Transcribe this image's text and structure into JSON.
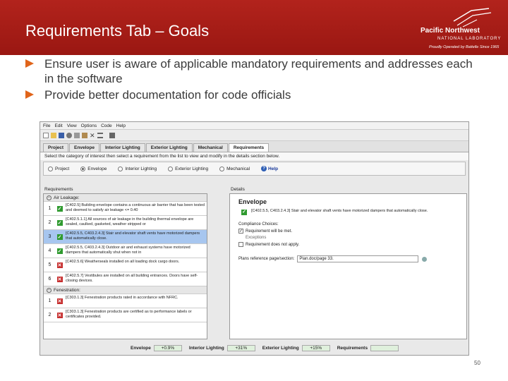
{
  "slide": {
    "title": "Requirements Tab – Goals",
    "bullets": [
      "Ensure user is aware of applicable mandatory requirements and addresses each in the software",
      "Provide better documentation for code officials"
    ],
    "page_number": "50",
    "colors": {
      "header": "#a81c15",
      "bullet": "#e0641a"
    }
  },
  "logo": {
    "name": "Pacific Northwest",
    "subtitle": "NATIONAL LABORATORY",
    "tagline": "Proudly Operated by Battelle Since 1965"
  },
  "app": {
    "menu": [
      "File",
      "Edit",
      "View",
      "Options",
      "Code",
      "Help"
    ],
    "tabs": [
      "Project",
      "Envelope",
      "Interior Lighting",
      "Exterior Lighting",
      "Mechanical",
      "Requirements"
    ],
    "active_tab": "Requirements",
    "instruction": "Select the category of interest then select a requirement from the list to view and modify in the details section below.",
    "categories": [
      "Project",
      "Envelope",
      "Interior Lighting",
      "Exterior Lighting",
      "Mechanical"
    ],
    "selected_category": "Envelope",
    "help_label": "Help",
    "requirements_label": "Requirements",
    "groups": [
      {
        "name": "Air Leakage:",
        "rows": [
          {
            "num": "1",
            "status": "ok",
            "text": "[C402.5] Building envelope contains a continuous air barrier that has been tested and deemed to satisfy air leakage <= 0.40"
          },
          {
            "num": "2",
            "status": "ok",
            "text": "[C402.5.1.1] All sources of air leakage in the building thermal envelope are sealed, caulked, gasketed, weather stripped or"
          },
          {
            "num": "3",
            "status": "ok",
            "text": "[C402.5.5, C403.2.4.3] Stair and elevator shaft vents have motorized dampers that automatically close."
          },
          {
            "num": "4",
            "status": "ok",
            "text": "[C402.5.5, C403.2.4.3] Outdoor air and exhaust systems have motorized dampers that automatically shut when not in"
          },
          {
            "num": "5",
            "status": "bad",
            "text": "[C402.5.6] Weatherseals installed on all loading dock cargo doors."
          },
          {
            "num": "6",
            "status": "bad",
            "text": "[C402.5.7] Vestibules are installed on all building entrances. Doors have self-closing devices."
          }
        ]
      },
      {
        "name": "Fenestration:",
        "rows": [
          {
            "num": "1",
            "status": "bad",
            "text": "[C303.1.3] Fenestration products rated in accordance with NFRC."
          },
          {
            "num": "2",
            "status": "bad",
            "text": "[C303.1.3] Fenestration products are certified as to performance labels or certificates provided."
          }
        ]
      }
    ],
    "details": {
      "label": "Details",
      "title": "Envelope",
      "requirement": "[C402.5.5, C403.2.4.3] Stair and elevator shaft vents have motorized dampers that automatically close.",
      "compliance_label": "Compliance Choices:",
      "met_label": "Requirement will be met.",
      "met_checked": true,
      "exceptions_label": "Exceptions",
      "not_apply_label": "Requirement does not apply.",
      "plans_label": "Plans reference page/section:",
      "plans_value": "Plan.doc/page 33."
    },
    "status_bar": [
      {
        "label": "Envelope",
        "value": "+0.9%"
      },
      {
        "label": "Interior Lighting",
        "value": "+31%"
      },
      {
        "label": "Exterior Lighting",
        "value": "+15%"
      },
      {
        "label": "Requirements",
        "value": ""
      }
    ]
  }
}
